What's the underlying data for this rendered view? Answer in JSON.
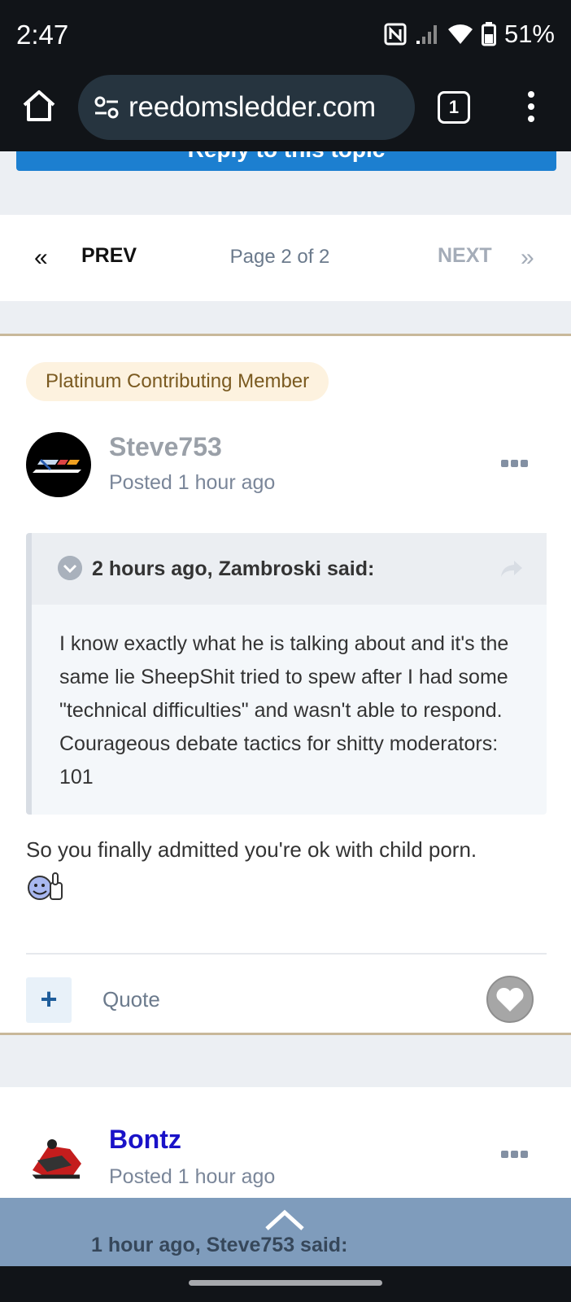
{
  "status_bar": {
    "time": "2:47",
    "battery": "51%"
  },
  "browser": {
    "url": "reedomsledder.com",
    "tab_count": "1"
  },
  "reply_button": {
    "label": "Reply to this topic"
  },
  "pagination": {
    "prev_icon": "«",
    "prev_label": "PREV",
    "page_label": "Page 2 of 2",
    "next_label": "NEXT",
    "next_icon": "»"
  },
  "post1": {
    "badge": "Platinum Contributing Member",
    "username": "Steve753",
    "username_color": "#9aa0a8",
    "posted": "Posted 1 hour ago",
    "quote": {
      "cite": "2 hours ago, Zambroski said:",
      "body": "I know exactly what he is talking about and it's the same lie SheepShit tried to spew after I had some \"technical difficulties\" and wasn't able to respond.  Courageous debate tactics for shitty moderators: 101"
    },
    "text": "So you finally admitted you're ok with child porn.",
    "actions": {
      "plus": "+",
      "quote": "Quote"
    }
  },
  "post2": {
    "username": "Bontz",
    "username_color": "#1a12c8",
    "posted": "Posted 1 hour ago",
    "quote_cite": "1 hour ago, Steve753 said:"
  },
  "colors": {
    "accent": "#1c7fd0",
    "quote_bg": "#f4f7fa"
  }
}
